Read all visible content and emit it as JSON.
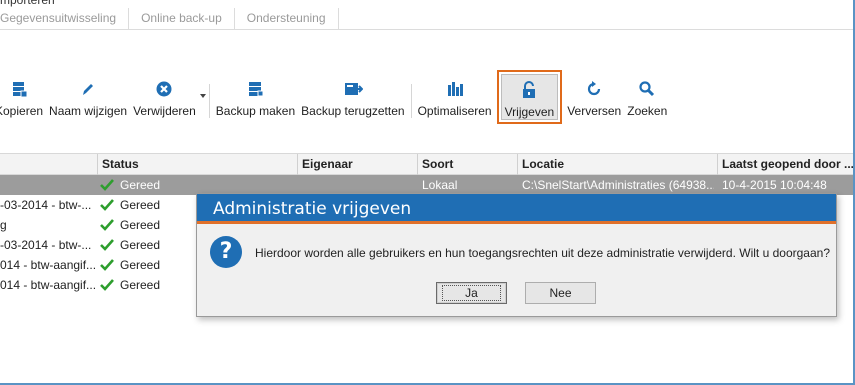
{
  "window": {
    "title_fragment": "mporteren"
  },
  "tabs": [
    "Gegevensuitwisseling",
    "Online back-up",
    "Ondersteuning"
  ],
  "toolbar": {
    "copy": "Kopieren",
    "rename": "Naam wijzigen",
    "delete": "Verwijderen",
    "backup": "Backup maken",
    "restore": "Backup terugzetten",
    "optimize": "Optimaliseren",
    "release": "Vrijgeven",
    "refresh": "Verversen",
    "search": "Zoeken"
  },
  "grid": {
    "columns": [
      "Status",
      "Eigenaar",
      "Soort",
      "Locatie",
      "Laatst geopend door ..."
    ],
    "rows": [
      {
        "name": "",
        "status": "Gereed",
        "owner": "",
        "type": "Lokaal",
        "location": "C:\\SnelStart\\Administraties (64938...",
        "last_opened": "10-4-2015 10:04:48",
        "selected": true
      },
      {
        "name": "-03-2014 - btw-...",
        "status": "Gereed",
        "owner": "",
        "type": "",
        "location": "",
        "last_opened": "",
        "selected": false
      },
      {
        "name": "g",
        "status": "Gereed",
        "owner": "",
        "type": "",
        "location": "",
        "last_opened": "",
        "selected": false
      },
      {
        "name": "-03-2014 - btw-...",
        "status": "Gereed",
        "owner": "",
        "type": "",
        "location": "",
        "last_opened": "",
        "selected": false
      },
      {
        "name": "014 - btw-aangif...",
        "status": "Gereed",
        "owner": "",
        "type": "",
        "location": "",
        "last_opened": "",
        "selected": false
      },
      {
        "name": "014 - btw-aangif...",
        "status": "Gereed",
        "owner": "",
        "type": "",
        "location": "",
        "last_opened": "",
        "selected": false
      }
    ]
  },
  "dialog": {
    "title": "Administratie vrijgeven",
    "message": "Hierdoor worden alle gebruikers en hun toegangsrechten uit deze administratie verwijderd. Wilt u doorgaan?",
    "yes": "Ja",
    "no": "Nee",
    "icon": "question-icon"
  },
  "colors": {
    "accent": "#1f6eb4",
    "highlight": "#e06a1a",
    "check": "#2e9e2e",
    "selected_row": "#9c9c9c"
  }
}
